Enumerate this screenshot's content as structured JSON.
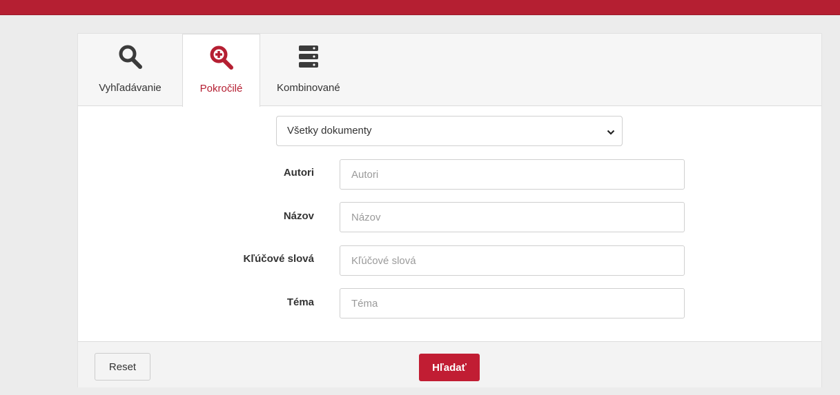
{
  "colors": {
    "accent": "#b51f32",
    "button_primary": "#c11d33",
    "tab_active_text": "#b51f32"
  },
  "tabs": [
    {
      "label": "Vyhľadávanie",
      "icon": "search-icon"
    },
    {
      "label": "Pokročilé",
      "icon": "advanced-search-icon",
      "active": true
    },
    {
      "label": "Kombinované",
      "icon": "stack-icon"
    }
  ],
  "document_type": {
    "selected": "Všetky dokumenty"
  },
  "fields": {
    "authors": {
      "label": "Autori",
      "placeholder": "Autori",
      "value": ""
    },
    "title": {
      "label": "Názov",
      "placeholder": "Názov",
      "value": ""
    },
    "keywords": {
      "label": "Kľúčové slová",
      "placeholder": "Kľúčové slová",
      "value": ""
    },
    "topic": {
      "label": "Téma",
      "placeholder": "Téma",
      "value": ""
    }
  },
  "footer": {
    "reset_label": "Reset",
    "search_label": "Hľadať"
  }
}
